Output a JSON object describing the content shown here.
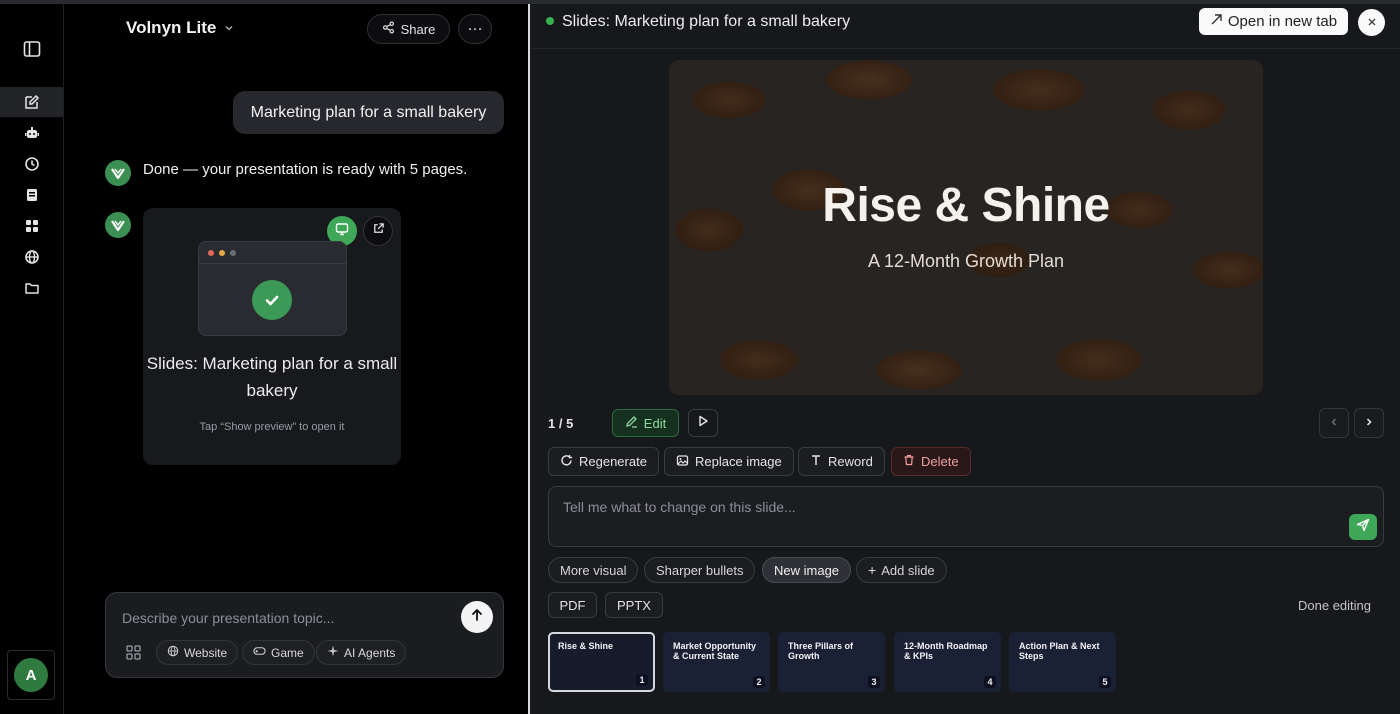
{
  "app": {
    "model_name": "Volnyn Lite",
    "share_label": "Share",
    "more_label": "…"
  },
  "rail": {
    "items": [
      "sidebar-toggle",
      "new-chat",
      "agents",
      "history",
      "library",
      "apps",
      "explore",
      "folders"
    ],
    "avatar_initial": "A"
  },
  "chat": {
    "user_message": "Marketing plan for a small bakery",
    "bot_message": "Done — your presentation is ready with 5 pages.",
    "card": {
      "title": "Slides: Marketing plan for a small bakery",
      "hint": "Tap “Show preview” to open it"
    },
    "composer": {
      "placeholder": "Describe your presentation topic...",
      "chips": [
        "Website",
        "Game",
        "AI Agents"
      ]
    }
  },
  "preview": {
    "title": "Slides: Marketing plan for a small bakery",
    "open_new_tab": "Open in new tab",
    "slide": {
      "title": "Rise & Shine",
      "subtitle": "A 12-Month Growth Plan"
    },
    "page_indicator": "1 / 5",
    "edit_label": "Edit",
    "actions": {
      "regenerate": "Regenerate",
      "replace_image": "Replace image",
      "reword": "Reword",
      "delete": "Delete"
    },
    "edit_placeholder": "Tell me what to change on this slide...",
    "suggestions": {
      "more_visual": "More visual",
      "sharper_bullets": "Sharper bullets",
      "new_image": "New image",
      "add_slide": "Add slide"
    },
    "formats": {
      "pdf": "PDF",
      "pptx": "PPTX"
    },
    "done_editing": "Done editing",
    "thumbnails": [
      {
        "label": "Rise & Shine",
        "num": "1"
      },
      {
        "label": "Market Opportunity & Current State",
        "num": "2"
      },
      {
        "label": "Three Pillars of Growth",
        "num": "3"
      },
      {
        "label": "12-Month Roadmap & KPIs",
        "num": "4"
      },
      {
        "label": "Action Plan & Next Steps",
        "num": "5"
      }
    ]
  },
  "colors": {
    "accent_green": "#3ea858",
    "status_dot": "#37b24d",
    "delete_red": "#f0a0a0"
  }
}
